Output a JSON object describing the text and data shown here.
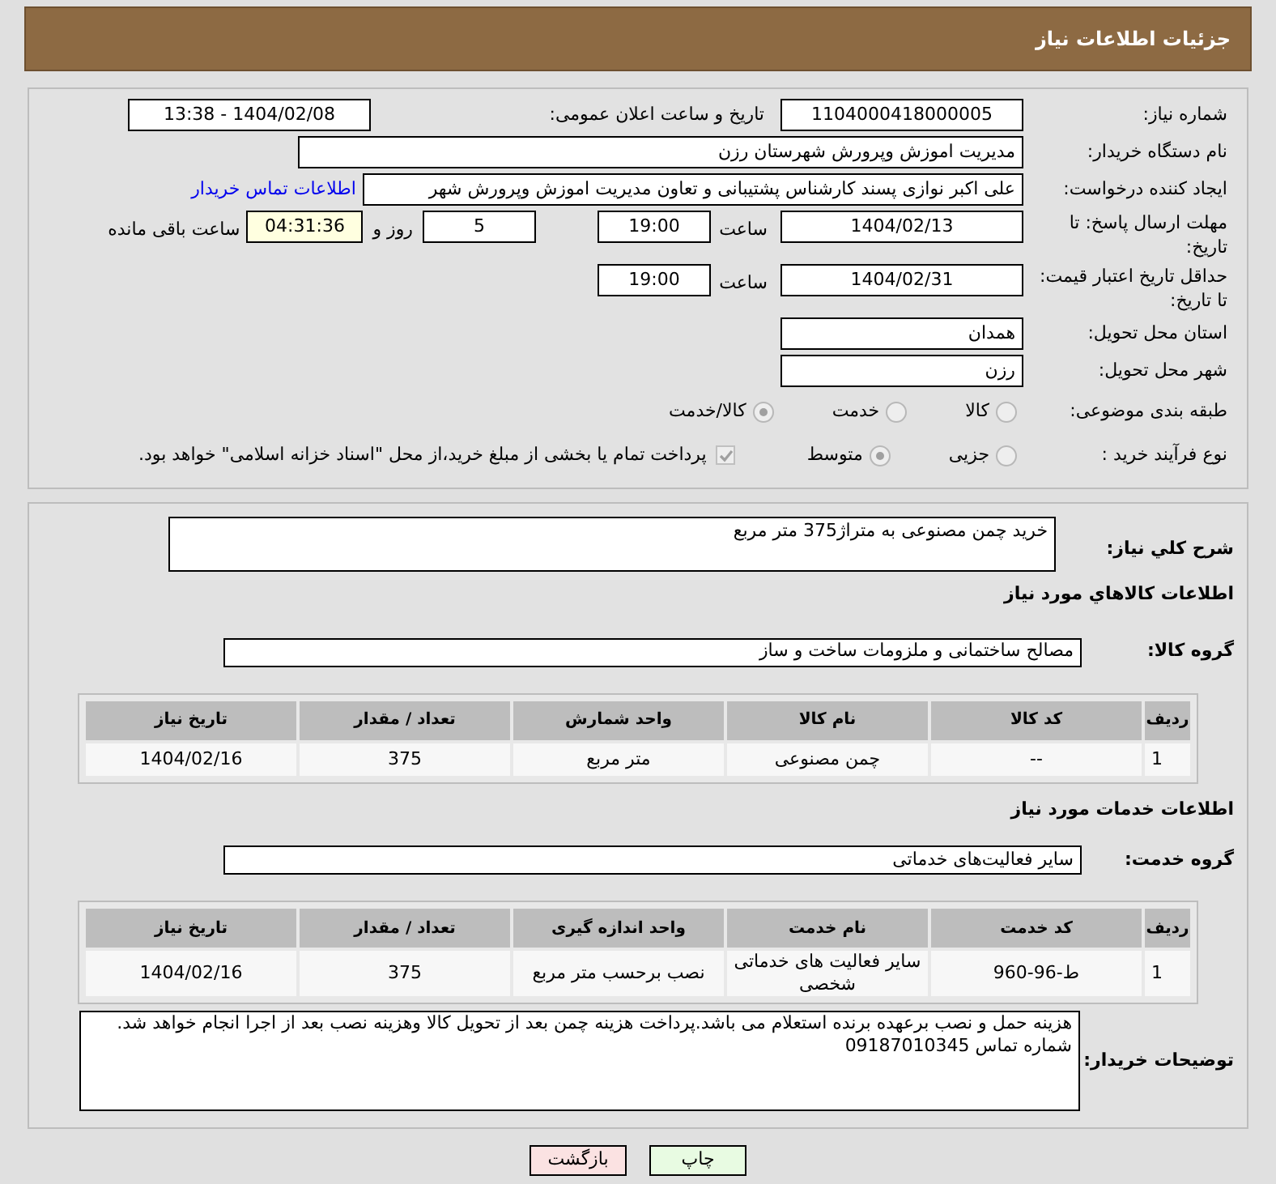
{
  "title": "جزئیات اطلاعات نیاز",
  "need_number": {
    "label": "شماره نیاز:",
    "value": "1104000418000005"
  },
  "announce": {
    "label": "تاریخ و ساعت اعلان عمومی:",
    "value": "1404/02/08 - 13:38"
  },
  "buyer": {
    "label": "نام دستگاه خریدار:",
    "value": "مدیریت اموزش وپرورش شهرستان رزن"
  },
  "creator": {
    "label": "ایجاد کننده درخواست:",
    "value": "علی اکبر نوازی پسند کارشناس پشتیبانی و تعاون مدیریت اموزش وپرورش شهر",
    "link": "اطلاعات تماس خریدار"
  },
  "reply_deadline": {
    "label": "مهلت ارسال پاسخ: تا تاریخ:",
    "date": "1404/02/13",
    "time_label": "ساعت",
    "time": "19:00",
    "days": "5",
    "days_label": "روز و",
    "remaining": "04:31:36",
    "remaining_label": "ساعت باقی مانده"
  },
  "price_validity": {
    "label": "حداقل تاریخ اعتبار قیمت: تا تاریخ:",
    "date": "1404/02/31",
    "time_label": "ساعت",
    "time": "19:00"
  },
  "province": {
    "label": "استان محل تحویل:",
    "value": "همدان"
  },
  "city": {
    "label": "شهر محل تحویل:",
    "value": "رزن"
  },
  "category": {
    "label": "طبقه بندی موضوعی:",
    "options": [
      {
        "label": "کالا",
        "selected": false
      },
      {
        "label": "خدمت",
        "selected": false
      },
      {
        "label": "کالا/خدمت",
        "selected": true
      }
    ]
  },
  "purchase_process": {
    "label": "نوع فرآیند خرید :",
    "options": [
      {
        "label": "جزیی",
        "selected": false
      },
      {
        "label": "متوسط",
        "selected": true
      }
    ],
    "payment_note": {
      "checked": true,
      "text": "پرداخت تمام یا بخشی از مبلغ خرید،از محل \"اسناد خزانه اسلامی\" خواهد بود."
    }
  },
  "description": {
    "label": "شرح كلي نياز:",
    "value": "خرید چمن مصنوعی به متراژ375 متر مربع"
  },
  "goods": {
    "heading": "اطلاعات كالاهاي مورد نياز",
    "group_label": "گروه کالا:",
    "group": "مصالح ساختمانی و ملزومات ساخت و ساز",
    "columns": [
      "ردیف",
      "کد کالا",
      "نام کالا",
      "واحد شمارش",
      "تعداد / مقدار",
      "تاریخ نیاز"
    ],
    "rows": [
      [
        "1",
        "--",
        "چمن مصنوعی",
        "متر مربع",
        "375",
        "1404/02/16"
      ]
    ]
  },
  "services": {
    "heading": "اطلاعات خدمات مورد نیاز",
    "group_label": "گروه خدمت:",
    "group": "سایر فعالیت‌های خدماتی",
    "columns": [
      "ردیف",
      "کد خدمت",
      "نام خدمت",
      "واحد اندازه گیری",
      "تعداد / مقدار",
      "تاریخ نیاز"
    ],
    "rows": [
      [
        "1",
        "ط-96-960",
        "سایر فعالیت های خدماتی شخصی",
        "نصب برحسب متر مربع",
        "375",
        "1404/02/16"
      ]
    ]
  },
  "buyer_notes": {
    "label": "توضیحات خریدار:",
    "value": "هزینه حمل و نصب برعهده برنده استعلام می باشد.پرداخت هزینه چمن بعد از تحویل کالا وهزینه نصب بعد از اجرا انجام خواهد شد. شماره تماس 09187010345"
  },
  "buttons": [
    {
      "label": "چاپ",
      "kind": "print"
    },
    {
      "label": "بازگشت",
      "kind": "back"
    }
  ]
}
